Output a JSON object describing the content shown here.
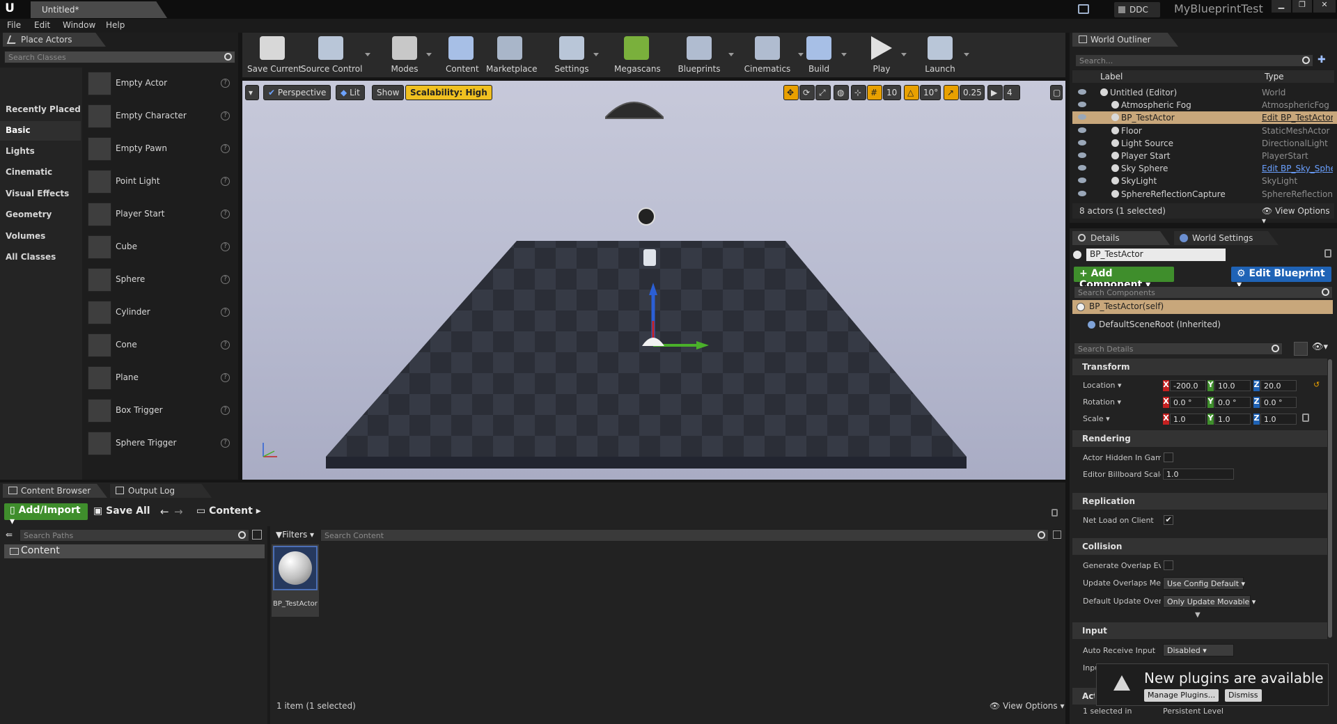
{
  "app": {
    "document_tab": "Untitled*",
    "ddc": "DDC",
    "project": "MyBlueprintTest"
  },
  "menu": [
    "File",
    "Edit",
    "Window",
    "Help"
  ],
  "place_actors": {
    "tab": "Place Actors",
    "search_placeholder": "Search Classes",
    "categories": [
      "Recently Placed",
      "Basic",
      "Lights",
      "Cinematic",
      "Visual Effects",
      "Geometry",
      "Volumes",
      "All Classes"
    ],
    "selected_category": "Basic",
    "items": [
      "Empty Actor",
      "Empty Character",
      "Empty Pawn",
      "Point Light",
      "Player Start",
      "Cube",
      "Sphere",
      "Cylinder",
      "Cone",
      "Plane",
      "Box Trigger",
      "Sphere Trigger"
    ],
    "help_glyph": "?"
  },
  "toolbar": [
    "Save Current",
    "Source Control",
    "Modes",
    "Content",
    "Marketplace",
    "Settings",
    "Megascans",
    "Blueprints",
    "Cinematics",
    "Build",
    "Play",
    "Launch"
  ],
  "viewport": {
    "perspective": "Perspective",
    "lit": "Lit",
    "show": "Show",
    "scalability": "Scalability: High",
    "grid_snap": "10",
    "rotation_snap": "10°",
    "scale_snap": "0.25",
    "camera_speed": "4"
  },
  "outliner": {
    "tab": "World Outliner",
    "search_placeholder": "Search...",
    "col_label": "Label",
    "col_type": "Type",
    "rows": [
      {
        "label": "Untitled (Editor)",
        "type": "World"
      },
      {
        "label": "Atmospheric Fog",
        "type": "AtmosphericFog"
      },
      {
        "label": "BP_TestActor",
        "type": "Edit BP_TestActor"
      },
      {
        "label": "Floor",
        "type": "StaticMeshActor"
      },
      {
        "label": "Light Source",
        "type": "DirectionalLight"
      },
      {
        "label": "Player Start",
        "type": "PlayerStart"
      },
      {
        "label": "Sky Sphere",
        "type": "Edit BP_Sky_Sphere"
      },
      {
        "label": "SkyLight",
        "type": "SkyLight"
      },
      {
        "label": "SphereReflectionCapture",
        "type": "SphereReflectionCapture"
      }
    ],
    "selected": "BP_TestActor",
    "footer": "8 actors (1 selected)",
    "view_options": "View Options"
  },
  "details": {
    "tab": "Details",
    "tab2": "World Settings",
    "actor_name": "BP_TestActor",
    "add_component": "Add Component",
    "edit_blueprint": "Edit Blueprint",
    "search_components": "Search Components",
    "components": [
      "BP_TestActor(self)",
      "DefaultSceneRoot (Inherited)"
    ],
    "search_details": "Search Details",
    "transform": {
      "title": "Transform",
      "location_label": "Location",
      "rotation_label": "Rotation",
      "scale_label": "Scale",
      "location": [
        "-200.0",
        "10.0",
        "20.0"
      ],
      "rotation": [
        "0.0 °",
        "0.0 °",
        "0.0 °"
      ],
      "scale": [
        "1.0",
        "1.0",
        "1.0"
      ]
    },
    "rendering": {
      "title": "Rendering",
      "hidden": "Actor Hidden In Game",
      "billboard": "Editor Billboard Scale",
      "billboard_value": "1.0"
    },
    "replication": {
      "title": "Replication",
      "net_load": "Net Load on Client",
      "net_load_checked": true
    },
    "collision": {
      "title": "Collision",
      "overlap": "Generate Overlap Events",
      "update_method": "Update Overlaps Method",
      "update_method_value": "Use Config Default",
      "default_update": "Default Update Overlap Method",
      "default_update_value": "Only Update Movable"
    },
    "input": {
      "title": "Input",
      "auto_receive": "Auto Receive Input",
      "auto_receive_value": "Disabled",
      "input_priority": "Input Priority"
    },
    "actor_section": "Actor",
    "selected_in": "1 selected in",
    "level": "Persistent Level"
  },
  "content_browser": {
    "tab": "Content Browser",
    "tab2": "Output Log",
    "add_import": "Add/Import",
    "save_all": "Save All",
    "path": "Content",
    "search_paths": "Search Paths",
    "tree_root": "Content",
    "filters": "Filters",
    "search_content": "Search Content",
    "asset_name": "BP_TestActor",
    "status": "1 item (1 selected)",
    "view_options": "View Options"
  },
  "notification": {
    "text": "New plugins are available",
    "manage": "Manage Plugins...",
    "dismiss": "Dismiss"
  },
  "colors": {
    "accent_orange": "#e8a000",
    "selection_row": "#c8a77b",
    "green_button": "#3f8e2c",
    "blue_button": "#1f63b6",
    "scalability_yellow": "#f0c020"
  }
}
